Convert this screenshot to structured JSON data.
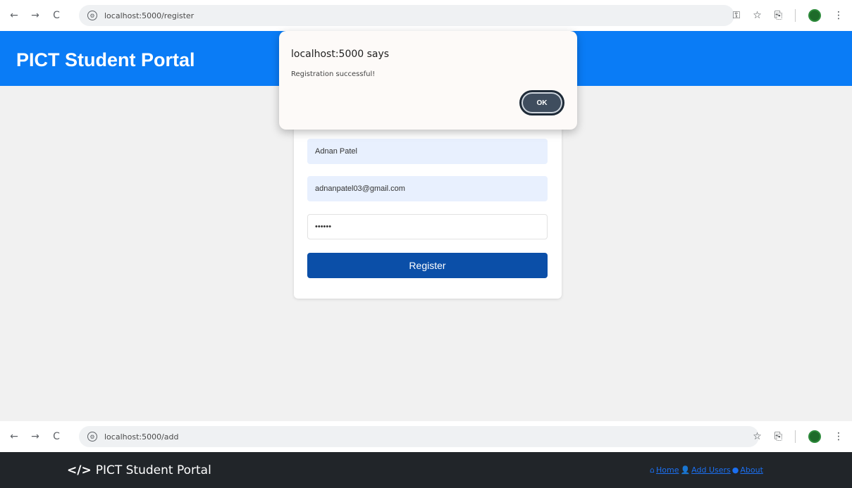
{
  "browser_top": {
    "url": "localhost:5000/register",
    "nav": {
      "back": "←",
      "forward": "→",
      "reload": "C"
    },
    "icons": [
      "key-icon",
      "star-icon",
      "extensions-icon",
      "profile-icon",
      "menu-icon"
    ]
  },
  "browser_bottom": {
    "url": "localhost:5000/add",
    "nav": {
      "back": "←",
      "forward": "→",
      "reload": "C"
    }
  },
  "header": {
    "title": "PICT Student Portal"
  },
  "form": {
    "name_value": "Adnan Patel",
    "email_value": "adnanpatel03@gmail.com",
    "password_value": "••••••",
    "register_label": "Register"
  },
  "dialog": {
    "title": "localhost:5000 says",
    "message": "Registration successful!",
    "ok_label": "OK"
  },
  "footer": {
    "brand_icon": "</>",
    "brand": "PICT Student Portal",
    "links": [
      "Home",
      "Add Users",
      "About"
    ]
  },
  "colors": {
    "header": "#0a7cf6",
    "register_button": "#0b4fa8",
    "footer": "#212529",
    "link": "#1b6ff0"
  }
}
